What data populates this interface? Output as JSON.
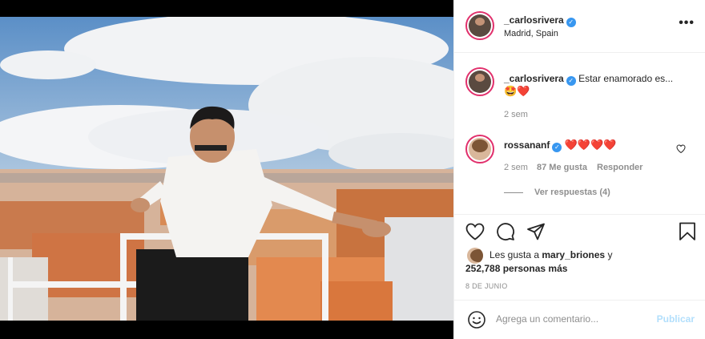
{
  "post": {
    "author": "_carlosrivera",
    "location": "Madrid, Spain",
    "more_label": "•••"
  },
  "caption": {
    "author": "_carlosrivera",
    "text": "Estar enamorado es...",
    "emojis": "🤩❤️",
    "time": "2 sem"
  },
  "comment": {
    "author": "rossananf",
    "text": "❤️❤️❤️❤️",
    "time": "2 sem",
    "likes": "87 Me gusta",
    "reply": "Responder",
    "view_replies": "Ver respuestas (4)"
  },
  "likes": {
    "prefix": "Les gusta a",
    "user": "mary_briones",
    "conj": "y",
    "count": "252,788 personas más"
  },
  "date": "8 DE JUNIO",
  "add_comment": {
    "placeholder": "Agrega un comentario...",
    "publish": "Publicar"
  },
  "colors": {
    "verified": "#3897f0",
    "story_ring": "#e1306c",
    "publish_disabled": "#b2dffc",
    "heart": "#ed4956"
  }
}
